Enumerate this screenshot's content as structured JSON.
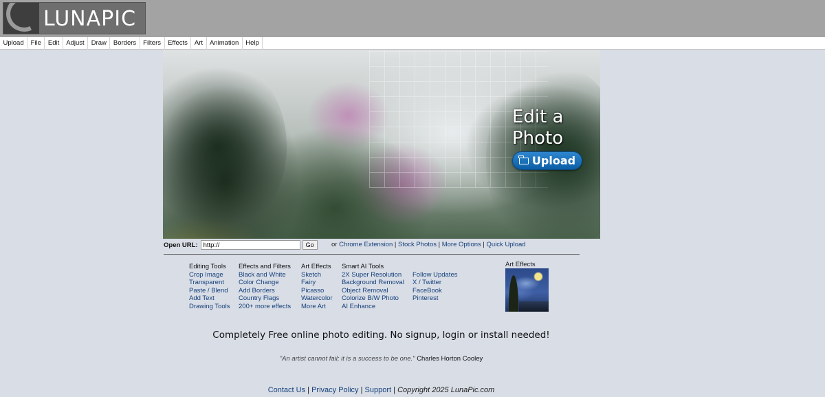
{
  "brand": {
    "logo_text": "LUNAPIC"
  },
  "menu": [
    "Upload",
    "File",
    "Edit",
    "Adjust",
    "Draw",
    "Borders",
    "Filters",
    "Effects",
    "Art",
    "Animation",
    "Help"
  ],
  "hero": {
    "title": "Edit a Photo",
    "upload_label": "Upload"
  },
  "url_bar": {
    "label": "Open URL:",
    "value": "http://",
    "go_label": "Go",
    "or_text": "or",
    "links": [
      "Chrome Extension",
      "Stock Photos",
      "More Options",
      "Quick Upload"
    ],
    "separator": "|"
  },
  "tool_columns": [
    {
      "heading": "Editing Tools",
      "items": [
        "Crop Image",
        "Transparent",
        "Paste / Blend",
        "Add Text",
        "Drawing Tools"
      ]
    },
    {
      "heading": "Effects and Filters",
      "items": [
        "Black and White",
        "Color Change",
        "Add Borders",
        "Country Flags",
        "200+ more effects"
      ]
    },
    {
      "heading": "Art Effects",
      "items": [
        "Sketch",
        "Fairy",
        "Picasso",
        "Watercolor",
        "More Art"
      ]
    },
    {
      "heading": "Smart AI Tools",
      "items": [
        "2X Super Resolution",
        "Background Removal",
        "Object Removal",
        "Colorize B/W Photo",
        "AI Enhance"
      ]
    },
    {
      "heading": "",
      "items": [
        "Follow Updates",
        "X / Twitter",
        "FaceBook",
        "Pinterest"
      ]
    }
  ],
  "art_thumb": {
    "label": "Art Effects"
  },
  "tagline": "Completely Free online photo editing. No signup, login or install needed!",
  "quote": {
    "text": "\"An artist cannot fail; it is a success to be one.\"",
    "author": "Charles Horton Cooley"
  },
  "footer": {
    "links": [
      "Contact Us",
      "Privacy Policy",
      "Support"
    ],
    "separator": "|",
    "copyright": "Copyright 2025 LunaPic.com"
  },
  "colors": {
    "header_bg": "#a3a3a3",
    "page_bg": "#d8dde6",
    "link": "#16407a",
    "upload_button": "#0b5ea6"
  }
}
